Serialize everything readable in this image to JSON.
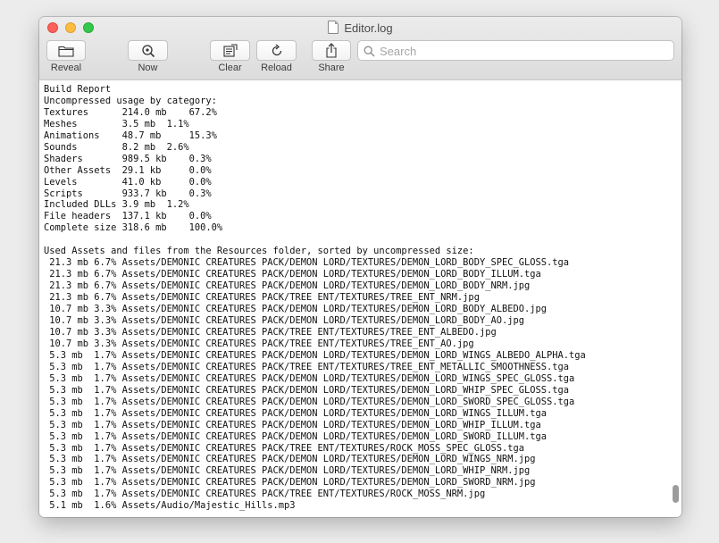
{
  "window": {
    "title": "Editor.log"
  },
  "toolbar": {
    "reveal": "Reveal",
    "now": "Now",
    "clear": "Clear",
    "reload": "Reload",
    "share": "Share"
  },
  "search": {
    "placeholder": "Search"
  },
  "log_lines": [
    "-------------------------------------------------------------------------------",
    "Build Report",
    "Uncompressed usage by category:",
    "Textures      214.0 mb    67.2%",
    "Meshes        3.5 mb  1.1%",
    "Animations    48.7 mb     15.3%",
    "Sounds        8.2 mb  2.6%",
    "Shaders       989.5 kb    0.3%",
    "Other Assets  29.1 kb     0.0%",
    "Levels        41.0 kb     0.0%",
    "Scripts       933.7 kb    0.3%",
    "Included DLLs 3.9 mb  1.2%",
    "File headers  137.1 kb    0.0%",
    "Complete size 318.6 mb    100.0%",
    "",
    "Used Assets and files from the Resources folder, sorted by uncompressed size:",
    " 21.3 mb 6.7% Assets/DEMONIC CREATURES PACK/DEMON LORD/TEXTURES/DEMON_LORD_BODY_SPEC_GLOSS.tga",
    " 21.3 mb 6.7% Assets/DEMONIC CREATURES PACK/DEMON LORD/TEXTURES/DEMON_LORD_BODY_ILLUM.tga",
    " 21.3 mb 6.7% Assets/DEMONIC CREATURES PACK/DEMON LORD/TEXTURES/DEMON_LORD_BODY_NRM.jpg",
    " 21.3 mb 6.7% Assets/DEMONIC CREATURES PACK/TREE ENT/TEXTURES/TREE_ENT_NRM.jpg",
    " 10.7 mb 3.3% Assets/DEMONIC CREATURES PACK/DEMON LORD/TEXTURES/DEMON_LORD_BODY_ALBEDO.jpg",
    " 10.7 mb 3.3% Assets/DEMONIC CREATURES PACK/DEMON LORD/TEXTURES/DEMON_LORD_BODY_AO.jpg",
    " 10.7 mb 3.3% Assets/DEMONIC CREATURES PACK/TREE ENT/TEXTURES/TREE_ENT_ALBEDO.jpg",
    " 10.7 mb 3.3% Assets/DEMONIC CREATURES PACK/TREE ENT/TEXTURES/TREE_ENT_AO.jpg",
    " 5.3 mb  1.7% Assets/DEMONIC CREATURES PACK/DEMON LORD/TEXTURES/DEMON_LORD_WINGS_ALBEDO_ALPHA.tga",
    " 5.3 mb  1.7% Assets/DEMONIC CREATURES PACK/TREE ENT/TEXTURES/TREE_ENT_METALLIC_SMOOTHNESS.tga",
    " 5.3 mb  1.7% Assets/DEMONIC CREATURES PACK/DEMON LORD/TEXTURES/DEMON_LORD_WINGS_SPEC_GLOSS.tga",
    " 5.3 mb  1.7% Assets/DEMONIC CREATURES PACK/DEMON LORD/TEXTURES/DEMON_LORD_WHIP_SPEC_GLOSS.tga",
    " 5.3 mb  1.7% Assets/DEMONIC CREATURES PACK/DEMON LORD/TEXTURES/DEMON_LORD_SWORD_SPEC_GLOSS.tga",
    " 5.3 mb  1.7% Assets/DEMONIC CREATURES PACK/DEMON LORD/TEXTURES/DEMON_LORD_WINGS_ILLUM.tga",
    " 5.3 mb  1.7% Assets/DEMONIC CREATURES PACK/DEMON LORD/TEXTURES/DEMON_LORD_WHIP_ILLUM.tga",
    " 5.3 mb  1.7% Assets/DEMONIC CREATURES PACK/DEMON LORD/TEXTURES/DEMON_LORD_SWORD_ILLUM.tga",
    " 5.3 mb  1.7% Assets/DEMONIC CREATURES PACK/TREE ENT/TEXTURES/ROCK_MOSS_SPEC_GLOSS.tga",
    " 5.3 mb  1.7% Assets/DEMONIC CREATURES PACK/DEMON LORD/TEXTURES/DEMON_LORD_WINGS_NRM.jpg",
    " 5.3 mb  1.7% Assets/DEMONIC CREATURES PACK/DEMON LORD/TEXTURES/DEMON_LORD_WHIP_NRM.jpg",
    " 5.3 mb  1.7% Assets/DEMONIC CREATURES PACK/DEMON LORD/TEXTURES/DEMON_LORD_SWORD_NRM.jpg",
    " 5.3 mb  1.7% Assets/DEMONIC CREATURES PACK/TREE ENT/TEXTURES/ROCK_MOSS_NRM.jpg",
    " 5.1 mb  1.6% Assets/Audio/Majestic_Hills.mp3"
  ],
  "colors": {
    "close": "#fc605b",
    "minimize": "#fdbc40",
    "zoom": "#34c84a"
  },
  "icons": {
    "reveal": "folder-icon",
    "now": "scroll-to-now-icon",
    "clear": "clear-log-icon",
    "reload": "reload-icon",
    "share": "share-icon",
    "search": "search-icon",
    "document": "document-icon"
  }
}
